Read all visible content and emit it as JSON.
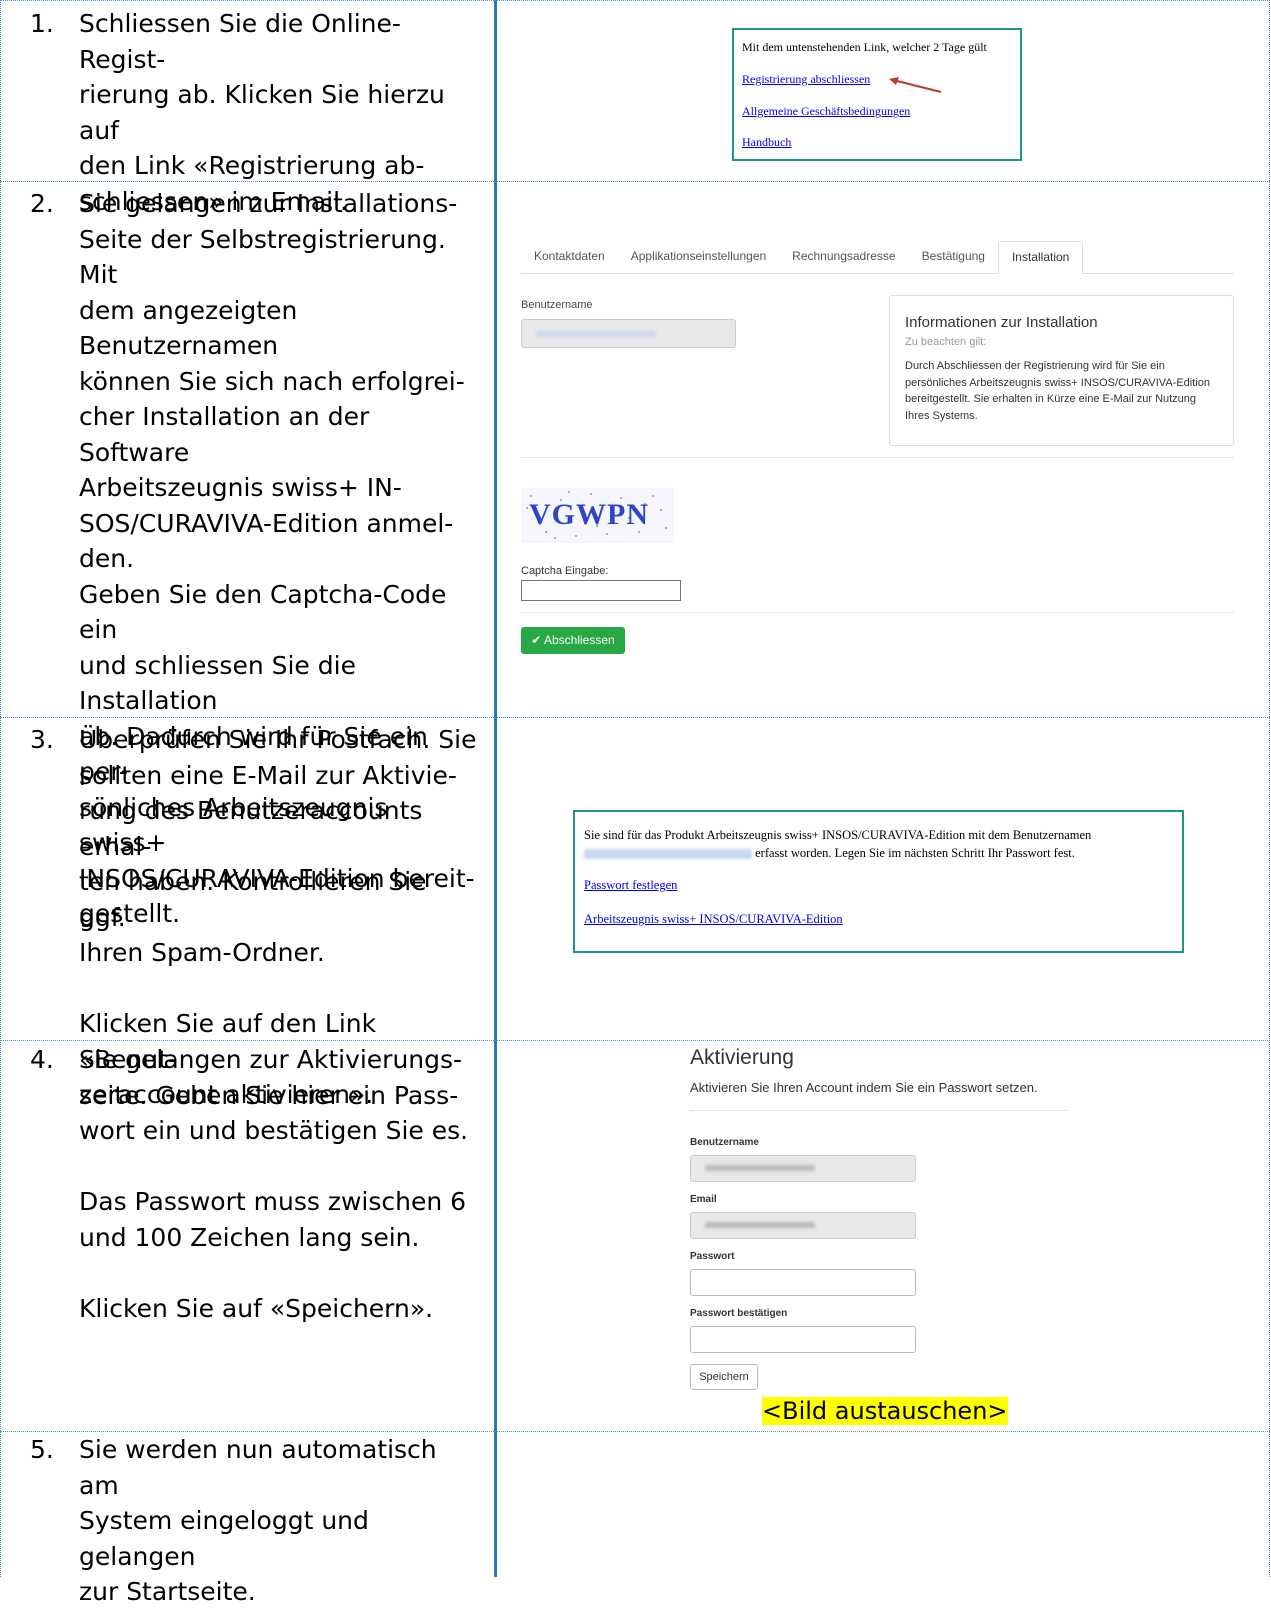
{
  "steps": [
    {
      "num": "1.",
      "lines": [
        "Schliessen Sie die Online-Regist-",
        "rierung ab. Klicken Sie hierzu auf",
        "den Link «Registrierung ab-",
        "schliessen» im Email."
      ]
    },
    {
      "num": "2.",
      "lines": [
        "Sie gelangen zur Installations-",
        "Seite der Selbstregistrierung. Mit",
        "dem angezeigten Benutzernamen",
        "können Sie sich nach erfolgrei-",
        "cher Installation an der Software",
        "Arbeitszeugnis swiss+ IN-",
        "SOS/CURAVIVA-Edition anmel-",
        "den.",
        "Geben Sie den Captcha-Code ein",
        "und schliessen Sie die Installation",
        "ab. Dadurch wird für Sie ein per-",
        "sönliches Arbeitszeugnis swiss+",
        "INSOS/CURAVIVA-Edition bereit-",
        "gestellt."
      ]
    },
    {
      "num": "3.",
      "lines": [
        "Überprüfen Sie Ihr Postfach. Sie",
        "sollten eine E-Mail zur Aktivie-",
        "rung des Benutzeraccounts erhal-",
        "ten haben. Kontrollieren Sie ggf.",
        "Ihren Spam-Ordner.",
        "",
        "Klicken Sie auf den Link «Benut-",
        "zeraccount aktivieren»."
      ]
    },
    {
      "num": "4.",
      "lines": [
        "Sie gelangen zur Aktivierungs-",
        "seite. Geben Sie hier ein Pass-",
        "wort ein und bestätigen Sie es.",
        "",
        "Das Passwort muss zwischen 6",
        "und 100 Zeichen lang sein.",
        "",
        "Klicken Sie auf «Speichern»."
      ]
    },
    {
      "num": "5.",
      "lines": [
        "Sie werden nun automatisch am",
        "System eingeloggt und gelangen",
        "zur Startseite."
      ]
    }
  ],
  "email1": {
    "intro": "Mit dem untenstehenden Link, welcher 2 Tage gült",
    "link1": "Registrierung abschliessen",
    "link2": "Allgemeine Geschäftsbedingungen",
    "link3": "Handbuch"
  },
  "install": {
    "tabs": [
      "Kontaktdaten",
      "Applikationseinstellungen",
      "Rechnungsadresse",
      "Bestätigung",
      "Installation"
    ],
    "username_label": "Benutzername",
    "info_title": "Informationen zur Installation",
    "info_sub": "Zu beachten gilt:",
    "info_text": "Durch Abschliessen der Registrierung wird für Sie ein persönliches Arbeitszeugnis swiss+ INSOS/CURAVIVA-Edition bereitgestellt. Sie erhalten in Kürze eine E-Mail zur Nutzung Ihres Systems.",
    "captcha_text": "VGWPN",
    "captcha_label": "Captcha Eingabe:",
    "submit": "Abschliessen"
  },
  "email2": {
    "line1": "Sie sind für das Produkt Arbeitszeugnis swiss+ INSOS/CURAVIVA-Edition mit dem Benutzernamen",
    "line2": "erfasst worden. Legen Sie im nächsten Schritt Ihr Passwort fest.",
    "link1": "Passwort festlegen",
    "link2": "Arbeitszeugnis swiss+ INSOS/CURAVIVA-Edition"
  },
  "activation": {
    "title": "Aktivierung",
    "subtitle": "Aktivieren Sie Ihren Account indem Sie ein Passwort setzen.",
    "username_label": "Benutzername",
    "email_label": "Email",
    "password_label": "Passwort",
    "confirm_label": "Passwort bestätigen",
    "save": "Speichern",
    "note": "<Bild austauschen>"
  },
  "colors": {
    "accent_line": "#2e75b6",
    "teal": "#20948b",
    "green_button": "#28a745"
  }
}
